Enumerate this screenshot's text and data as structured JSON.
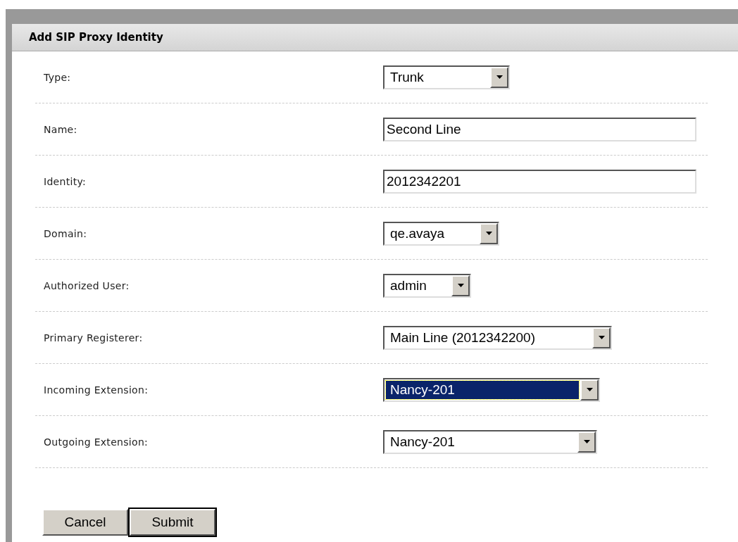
{
  "panel": {
    "title": "Add SIP Proxy Identity"
  },
  "fields": [
    {
      "label": "Type:",
      "kind": "select",
      "value": "Trunk",
      "selected": false
    },
    {
      "label": "Name:",
      "kind": "text",
      "value": "Second Line",
      "selected": false
    },
    {
      "label": "Identity:",
      "kind": "text",
      "value": "2012342201",
      "selected": false
    },
    {
      "label": "Domain:",
      "kind": "select",
      "value": "qe.avaya",
      "selected": false
    },
    {
      "label": "Authorized User:",
      "kind": "select",
      "value": "admin",
      "selected": false
    },
    {
      "label": "Primary Registerer:",
      "kind": "select",
      "value": "Main Line (2012342200)",
      "selected": false
    },
    {
      "label": "Incoming Extension:",
      "kind": "select",
      "value": "Nancy-201",
      "selected": true
    },
    {
      "label": "Outgoing Extension:",
      "kind": "select",
      "value": "Nancy-201",
      "selected": false
    }
  ],
  "buttons": [
    {
      "label": "Cancel",
      "default": false
    },
    {
      "label": "Submit",
      "default": true
    }
  ]
}
